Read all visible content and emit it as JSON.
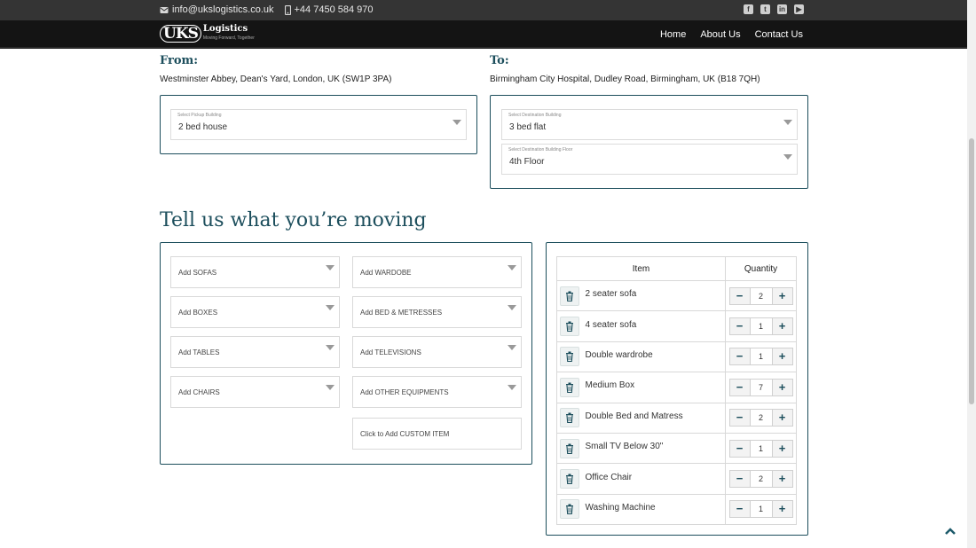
{
  "topbar": {
    "email": "info@ukslogistics.co.uk",
    "phone": "+44 7450 584 970",
    "social_icons": [
      "facebook-icon",
      "twitter-icon",
      "linkedin-icon",
      "youtube-icon"
    ]
  },
  "nav": {
    "logo_mark": "UKS",
    "logo_name": "Logistics",
    "logo_tagline": "Moving Forward, Together",
    "links": [
      "Home",
      "About Us",
      "Contact Us"
    ]
  },
  "from": {
    "label": "From:",
    "address": "Westminster Abbey, Dean's Yard, London, UK (SW1P 3PA)",
    "building_label": "Select Pickup Building",
    "building_value": "2 bed house"
  },
  "to": {
    "label": "To:",
    "address": "Birmingham City Hospital, Dudley Road, Birmingham, UK (B18 7QH)",
    "building_label": "Select Destination Building",
    "building_value": "3 bed flat",
    "floor_label": "Select Destination Building Floor",
    "floor_value": "4th Floor"
  },
  "moving": {
    "heading": "Tell us what you’re moving",
    "add_left": [
      "Add SOFAS",
      "Add BOXES",
      "Add TABLES",
      "Add CHAIRS"
    ],
    "add_right": [
      "Add WARDOBE",
      "Add BED & METRESSES",
      "Add TELEVISIONS",
      "Add OTHER EQUIPMENTS"
    ],
    "custom": "Click to Add CUSTOM ITEM"
  },
  "items_table": {
    "col_item": "Item",
    "col_qty": "Quantity",
    "rows": [
      {
        "name": "2 seater sofa",
        "qty": "2"
      },
      {
        "name": "4 seater sofa",
        "qty": "1"
      },
      {
        "name": "Double wardrobe",
        "qty": "1"
      },
      {
        "name": "Medium Box",
        "qty": "7"
      },
      {
        "name": "Double Bed and Matress",
        "qty": "2"
      },
      {
        "name": "Small TV Below 30\"",
        "qty": "1"
      },
      {
        "name": "Office Chair",
        "qty": "2"
      },
      {
        "name": "Washing Machine",
        "qty": "1"
      }
    ],
    "minus": "−",
    "plus": "+"
  },
  "colors": {
    "accent": "#1c4e5c",
    "topbar": "#343434",
    "navbar": "#141414"
  }
}
